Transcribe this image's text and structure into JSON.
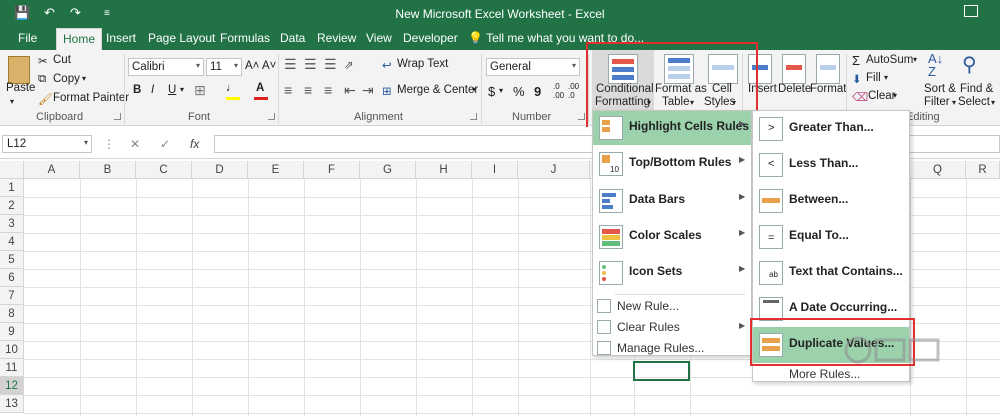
{
  "window": {
    "title": "New Microsoft Excel Worksheet - Excel"
  },
  "tabs": [
    "File",
    "Home",
    "Insert",
    "Page Layout",
    "Formulas",
    "Data",
    "Review",
    "View",
    "Developer"
  ],
  "tell_me": "Tell me what you want to do...",
  "ribbon": {
    "clipboard": {
      "paste": "Paste",
      "cut": "Cut",
      "copy": "Copy",
      "format_painter": "Format Painter",
      "label": "Clipboard"
    },
    "font": {
      "name": "Calibri",
      "size": "11",
      "bold": "B",
      "italic": "I",
      "underline": "U",
      "label": "Font"
    },
    "alignment": {
      "wrap_text": "Wrap Text",
      "merge_center": "Merge & Center",
      "label": "Alignment"
    },
    "number": {
      "format": "General",
      "currency": "$",
      "percent": "%",
      "comma": "9",
      "label": "Number"
    },
    "styles": {
      "conditional_formatting_1": "Conditional",
      "conditional_formatting_2": "Formatting",
      "format_as_table_1": "Format as",
      "format_as_table_2": "Table",
      "cell_styles_1": "Cell",
      "cell_styles_2": "Styles"
    },
    "cells": {
      "insert": "Insert",
      "delete": "Delete",
      "format": "Format"
    },
    "editing": {
      "autosum": "AutoSum",
      "fill": "Fill",
      "clear": "Clear",
      "sort_filter_1": "Sort &",
      "sort_filter_2": "Filter",
      "find_select_1": "Find &",
      "find_select_2": "Select",
      "label": "Editing"
    }
  },
  "formula_bar": {
    "name_box": "L12",
    "fx": "fx",
    "cancel": "✕",
    "enter": "✓",
    "value": ""
  },
  "grid": {
    "columns": [
      "A",
      "B",
      "C",
      "D",
      "E",
      "F",
      "G",
      "H",
      "I",
      "J",
      "Q",
      "R"
    ],
    "rows": [
      "1",
      "2",
      "3",
      "4",
      "5",
      "6",
      "7",
      "8",
      "9",
      "10",
      "11",
      "12",
      "13"
    ],
    "selected_row": "12"
  },
  "cf_menu": {
    "items": [
      {
        "label": "Highlight Cells Rules",
        "icon": "highlight-cells-icon"
      },
      {
        "label": "Top/Bottom Rules",
        "icon": "top-bottom-icon"
      },
      {
        "label": "Data Bars",
        "icon": "data-bars-icon"
      },
      {
        "label": "Color Scales",
        "icon": "color-scales-icon"
      },
      {
        "label": "Icon Sets",
        "icon": "icon-sets-icon"
      }
    ],
    "small_items": [
      "New Rule...",
      "Clear Rules",
      "Manage Rules..."
    ]
  },
  "highlight_submenu": {
    "items": [
      "Greater Than...",
      "Less Than...",
      "Between...",
      "Equal To...",
      "Text that Contains...",
      "A Date Occurring...",
      "Duplicate Values..."
    ],
    "more": "More Rules..."
  },
  "colors": {
    "excel_green": "#217346",
    "highlight_green": "#9bd1ab",
    "annotation_red": "#e03030"
  }
}
